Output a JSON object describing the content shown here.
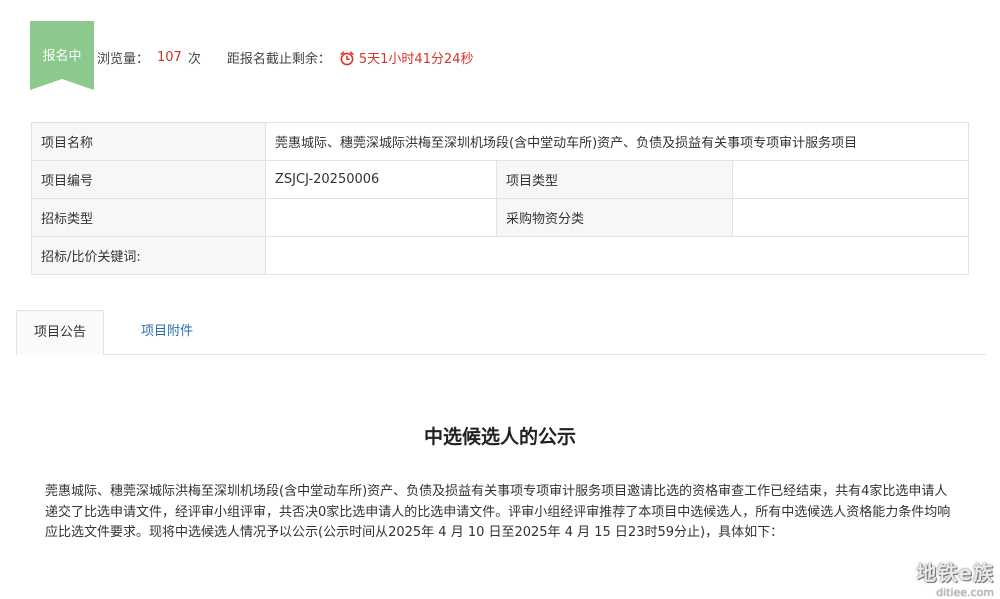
{
  "badge": {
    "label": "报名中"
  },
  "stats": {
    "views_label": "浏览量：",
    "views_count": "107",
    "views_unit": "次",
    "deadline_label": "距报名截止剩余：",
    "countdown": "5天1小时41分24秒",
    "colors": {
      "countdown": "#d9342b",
      "badge": "#8bc98c"
    },
    "clock_icon": "alarm-clock-icon"
  },
  "info_table": {
    "rows": [
      {
        "label": "项目名称",
        "value": "莞惠城际、穗莞深城际洪梅至深圳机场段(含中堂动车所)资产、负债及损益有关事项专项审计服务项目"
      },
      {
        "label": "项目编号",
        "value": "ZSJCJ-20250006",
        "label2": "项目类型",
        "value2": ""
      },
      {
        "label": "招标类型",
        "value": "",
        "label2": "采购物资分类",
        "value2": ""
      },
      {
        "label": "招标/比价关键词:",
        "value": ""
      }
    ]
  },
  "tabs": [
    {
      "label": "项目公告",
      "active": true
    },
    {
      "label": "项目附件",
      "active": false
    }
  ],
  "notice": {
    "title": "中选候选人的公示",
    "body": "莞惠城际、穗莞深城际洪梅至深圳机场段(含中堂动车所)资产、负债及损益有关事项专项审计服务项目邀请比选的资格审查工作已经结束，共有4家比选申请人递交了比选申请文件，经评审小组评审，共否决0家比选申请人的比选申请文件。评审小组经评审推荐了本项目中选候选人，所有中选候选人资格能力条件均响应比选文件要求。现将中选候选人情况予以公示(公示时间从2025年 4 月 10 日至2025年 4 月 15 日23时59分止)，具体如下："
  },
  "watermark": {
    "line1": "地铁e族",
    "line2": "ditiee.com"
  }
}
